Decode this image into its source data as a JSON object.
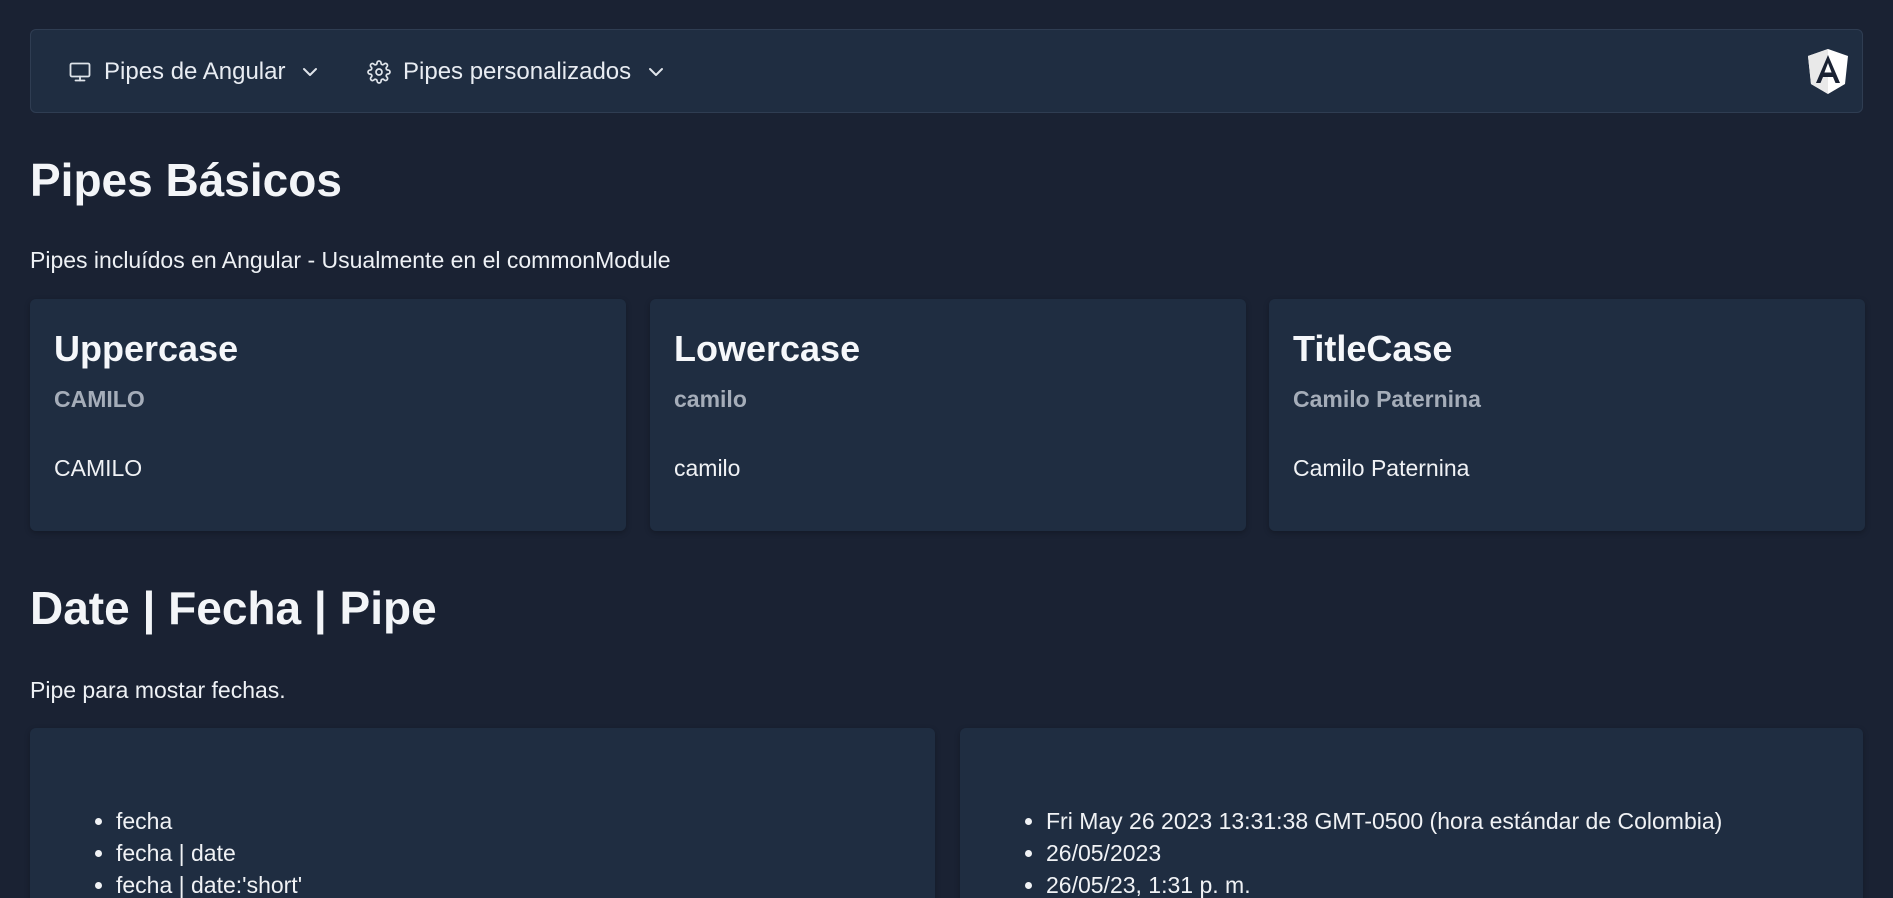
{
  "menubar": {
    "items": [
      {
        "label": "Pipes de Angular",
        "icon": "desktop-icon"
      },
      {
        "label": "Pipes personalizados",
        "icon": "gear-icon"
      }
    ],
    "logo": "angular-logo"
  },
  "basic": {
    "title": "Pipes Básicos",
    "subtitle": "Pipes incluídos en Angular - Usualmente en el commonModule",
    "cards": [
      {
        "title": "Uppercase",
        "subtitle": "CAMILO",
        "body": "CAMILO"
      },
      {
        "title": "Lowercase",
        "subtitle": "camilo",
        "body": "camilo"
      },
      {
        "title": "TitleCase",
        "subtitle": "Camilo Paternina",
        "body": "Camilo Paternina"
      }
    ]
  },
  "date": {
    "title": "Date | Fecha | Pipe",
    "subtitle": "Pipe para mostar fechas.",
    "left_items": [
      "fecha",
      "fecha | date",
      "fecha | date:'short'"
    ],
    "right_items": [
      "Fri May 26 2023 13:31:38 GMT-0500 (hora estándar de Colombia)",
      "26/05/2023",
      "26/05/23, 1:31 p. m."
    ]
  },
  "colors": {
    "background": "#1a2233",
    "surface": "#1f2d41",
    "muted_text": "#a5adb9"
  }
}
